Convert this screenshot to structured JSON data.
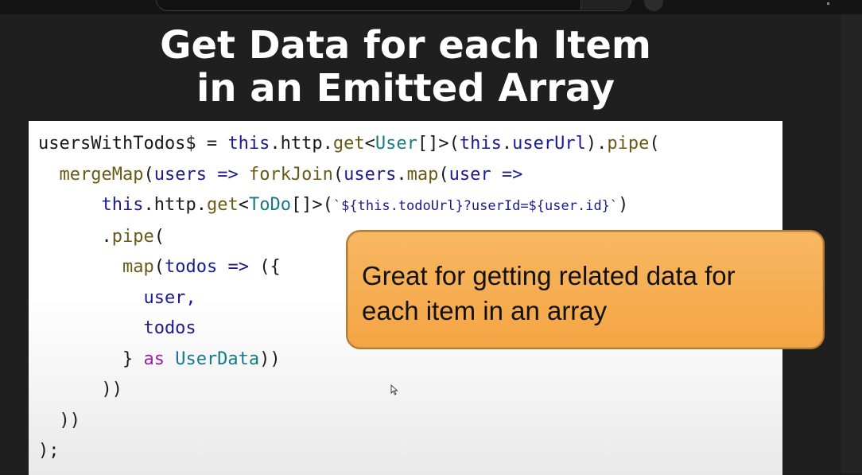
{
  "slide": {
    "title_line1": "Get Data for each Item",
    "title_line2": "in an Emitted Array",
    "callout_line1": "Great for getting related data for",
    "callout_line2": "each item in an array"
  },
  "code": {
    "l1": [
      "usersWithTodos$",
      " = ",
      "this",
      ".",
      "http",
      ".",
      "get",
      "<",
      "User",
      "[]>(",
      "this",
      ".",
      "userUrl",
      ").",
      "pipe",
      "("
    ],
    "l2": [
      "  ",
      "mergeMap",
      "(",
      "users",
      " ",
      "=>",
      " ",
      "forkJoin",
      "(",
      "users",
      ".",
      "map",
      "(",
      "user",
      " ",
      "=>"
    ],
    "l3": [
      "      ",
      "this",
      ".",
      "http",
      ".",
      "get",
      "<",
      "ToDo",
      "[]>(",
      "`${this.todoUrl}?userId=${user.id}`",
      ")"
    ],
    "l4": [
      "      .",
      "pipe",
      "("
    ],
    "l5": [
      "        ",
      "map",
      "(",
      "todos",
      " ",
      "=>",
      " ({"
    ],
    "l6": [
      "          user,"
    ],
    "l7": [
      "          todos"
    ],
    "l8": [
      "        } ",
      "as",
      " ",
      "UserData",
      "))"
    ],
    "l9": [
      "      ))"
    ],
    "l10": [
      "  ))"
    ],
    "l11": [
      ");"
    ]
  },
  "colors": {
    "callout_bg": "#f4a544",
    "title": "#ffffff",
    "keyword": "#1b1b8f",
    "function": "#6b5a16",
    "type": "#177a8a",
    "as": "#9b1f9b"
  },
  "icons": [
    "mouse-cursor-icon",
    "microphone-icon",
    "kebab-menu-icon"
  ]
}
